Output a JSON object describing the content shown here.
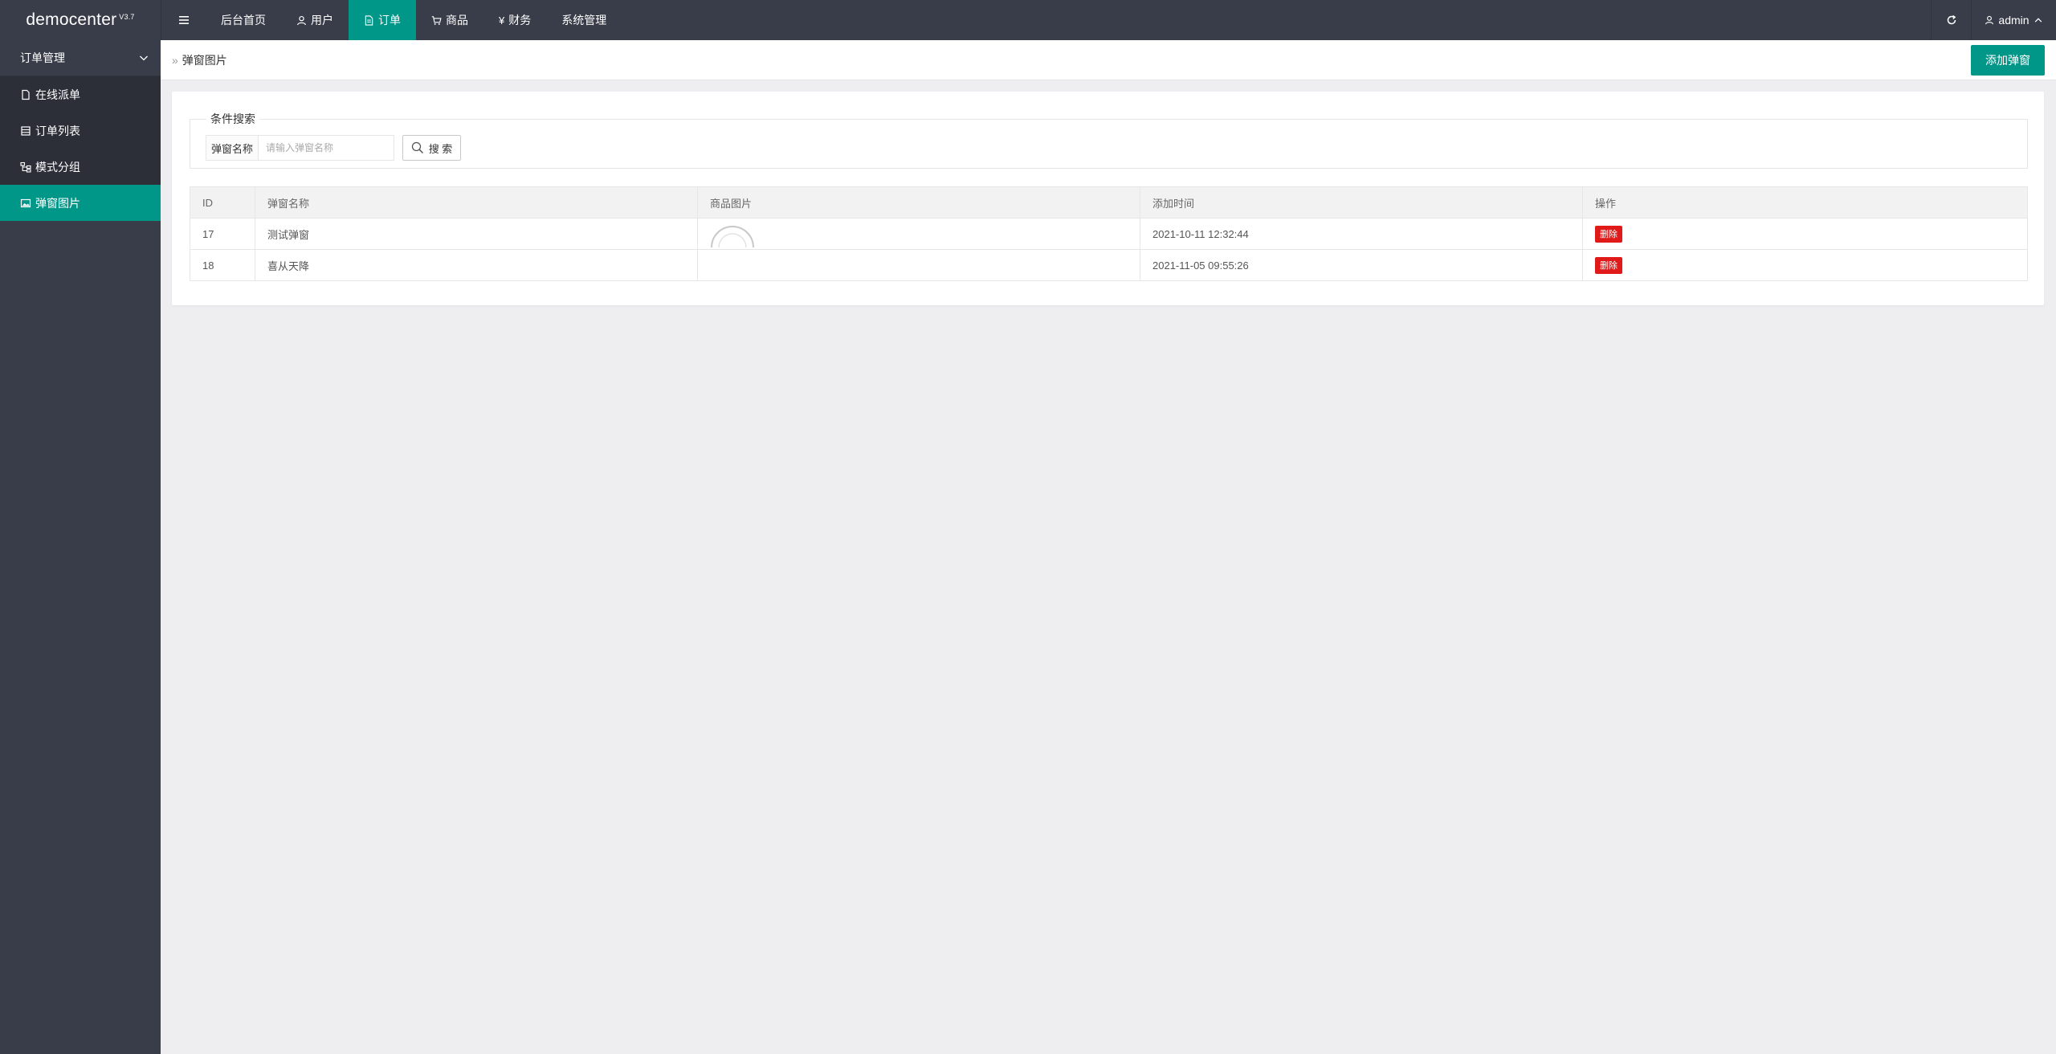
{
  "app": {
    "name": "democenter",
    "version": "V3.7"
  },
  "topnav": {
    "items": [
      {
        "label": "后台首页",
        "icon": "none"
      },
      {
        "label": "用户",
        "icon": "user-icon"
      },
      {
        "label": "订单",
        "icon": "document-icon",
        "active": true
      },
      {
        "label": "商品",
        "icon": "cart-icon"
      },
      {
        "label": "财务",
        "icon": "yen-icon"
      },
      {
        "label": "系统管理",
        "icon": "none"
      }
    ],
    "user": "admin"
  },
  "sidebar": {
    "group": "订单管理",
    "items": [
      {
        "label": "在线派单",
        "icon": "file-icon"
      },
      {
        "label": "订单列表",
        "icon": "list-icon"
      },
      {
        "label": "模式分组",
        "icon": "tree-icon"
      },
      {
        "label": "弹窗图片",
        "icon": "image-icon",
        "active": true
      }
    ]
  },
  "breadcrumb": {
    "current": "弹窗图片"
  },
  "toolbar": {
    "add_label": "添加弹窗"
  },
  "search": {
    "legend": "条件搜索",
    "field_label": "弹窗名称",
    "placeholder": "请输入弹窗名称",
    "value": "",
    "button_label": "搜 索"
  },
  "table": {
    "headers": [
      "ID",
      "弹窗名称",
      "商品图片",
      "添加时间",
      "操作"
    ],
    "rows": [
      {
        "id": "17",
        "name": "测试弹窗",
        "time": "2021-10-11 12:32:44",
        "action": "删除"
      },
      {
        "id": "18",
        "name": "喜从天降",
        "time": "2021-11-05 09:55:26",
        "action": "删除"
      }
    ]
  },
  "colors": {
    "dark": "#393d49",
    "accent": "#009688",
    "danger": "#e01919"
  }
}
